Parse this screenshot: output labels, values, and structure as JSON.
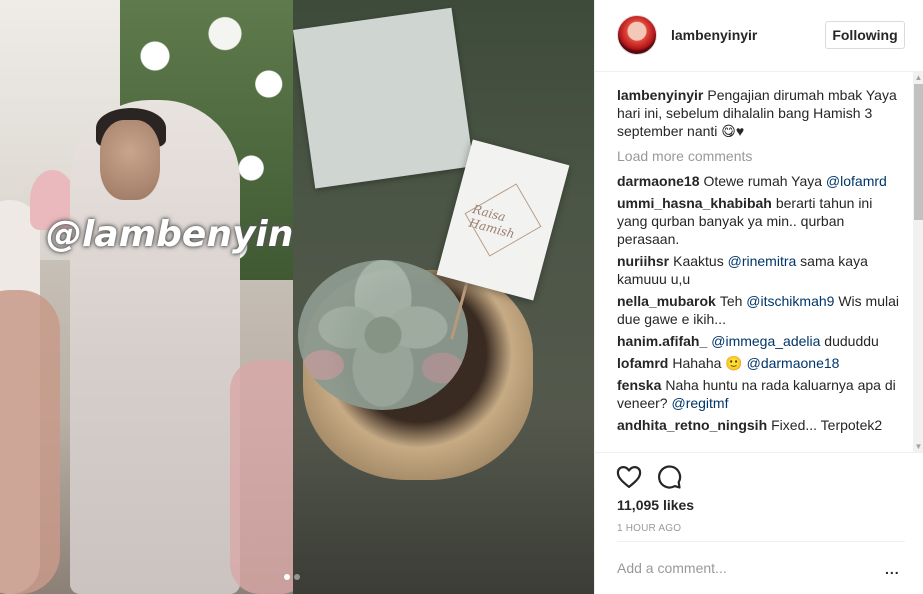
{
  "post": {
    "username": "lambenyinyir",
    "follow_label": "Following",
    "watermark": "@lambenyinyir",
    "tag_card_text": "Raisa Hamish",
    "carousel": {
      "count": 2,
      "active_index": 0
    }
  },
  "caption": {
    "user": "lambenyinyir",
    "text": "Pengajian dirumah mbak Yaya hari ini, sebelum dihalalin bang Hamish 3 september nanti 😋♥"
  },
  "load_more_label": "Load more comments",
  "comments": [
    {
      "user": "darmaone18",
      "text": "Otewe rumah Yaya",
      "mention": "@lofamrd",
      "after": ""
    },
    {
      "user": "ummi_hasna_khabibah",
      "text": "berarti tahun ini yang qurban banyak ya min.. qurban perasaan.",
      "mention": "",
      "after": ""
    },
    {
      "user": "nuriihsr",
      "text": "Kaaktus",
      "mention": "@rinemitra",
      "after": "sama kaya kamuuu u,u"
    },
    {
      "user": "nella_mubarok",
      "text": "Teh",
      "mention": "@itschikmah9",
      "after": "Wis mulai due gawe e ikih..."
    },
    {
      "user": "hanim.afifah_",
      "text": "",
      "mention": "@immega_adelia",
      "after": "dududdu"
    },
    {
      "user": "lofamrd",
      "text": "Hahaha 🙂",
      "mention": "@darmaone18",
      "after": ""
    },
    {
      "user": "fenska",
      "text": "Naha huntu na rada kaluarnya apa di veneer?",
      "mention": "@regitmf",
      "after": ""
    },
    {
      "user": "andhita_retno_ningsih",
      "text": "Fixed... Terpotek2",
      "mention": "",
      "after": ""
    }
  ],
  "actions": {
    "like_icon": "heart-icon",
    "comment_icon": "comment-bubble-icon"
  },
  "likes_text": "11,095 likes",
  "time_text": "1 HOUR AGO",
  "add_comment": {
    "placeholder": "Add a comment...",
    "more_label": "..."
  },
  "colors": {
    "text": "#262626",
    "muted": "#999999",
    "mention": "#003569",
    "border": "#efefef"
  }
}
